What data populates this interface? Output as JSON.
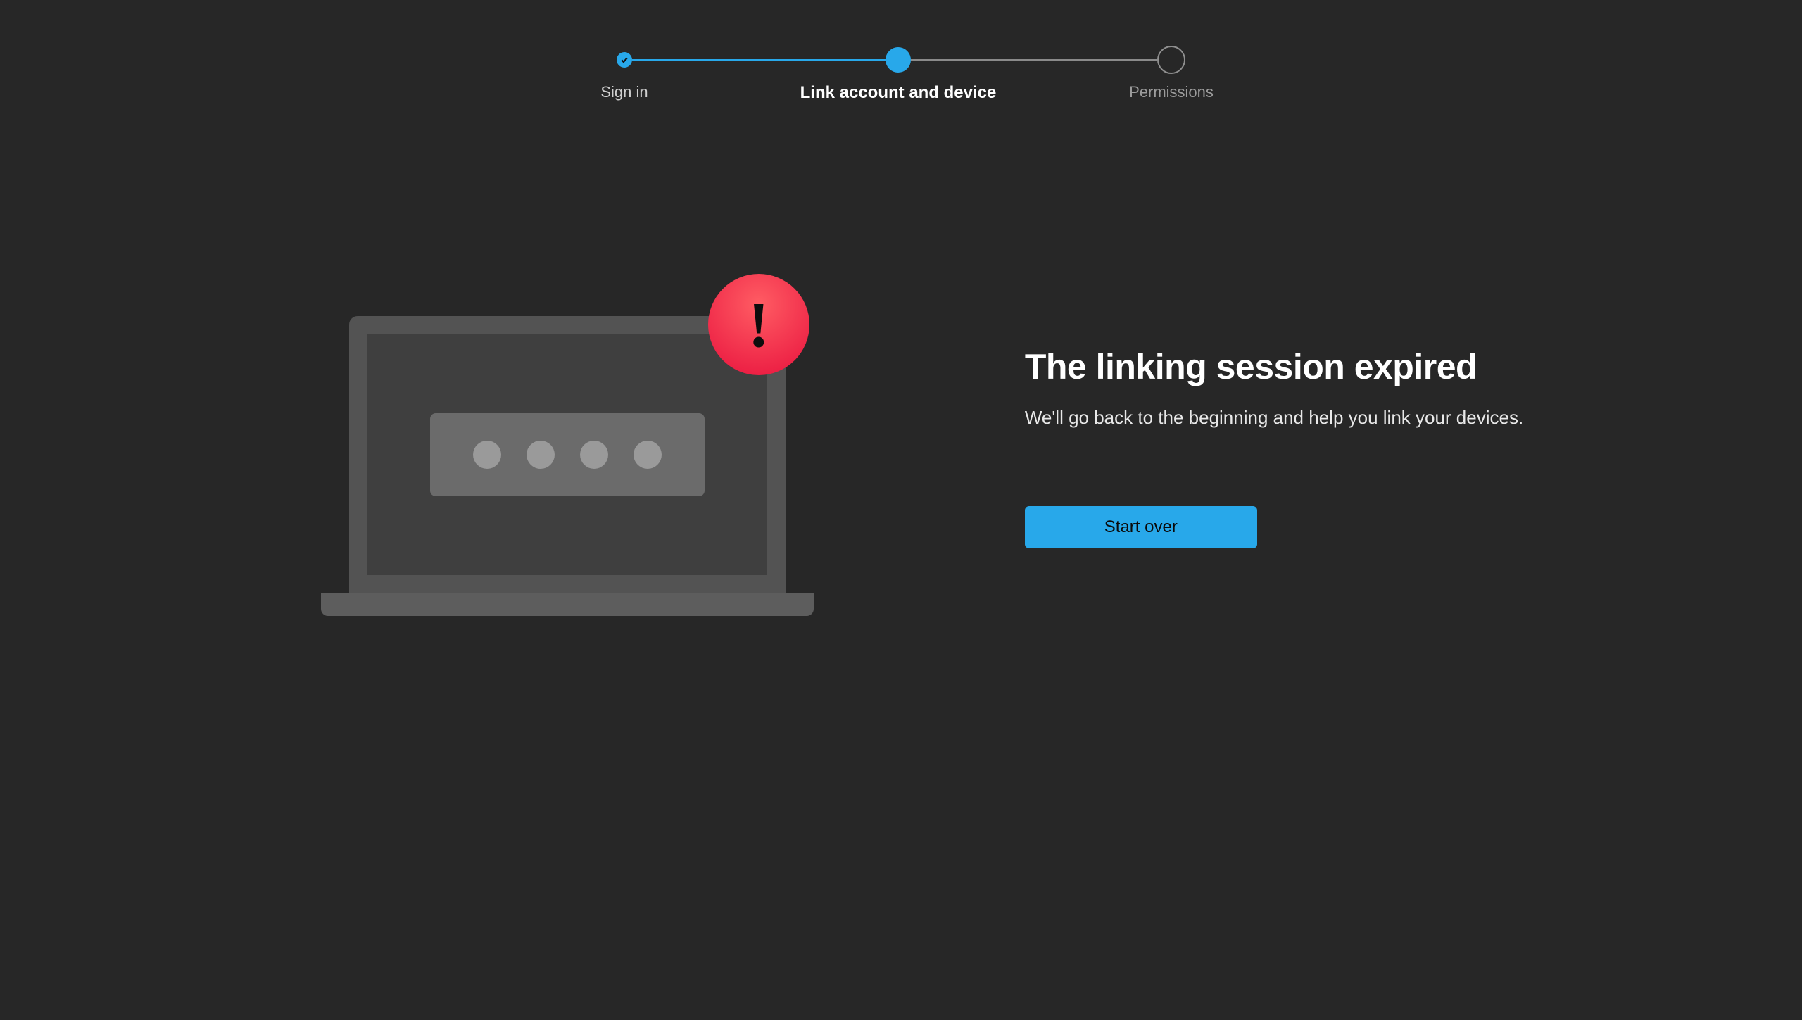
{
  "stepper": {
    "steps": [
      {
        "label": "Sign in",
        "state": "completed"
      },
      {
        "label": "Link account and device",
        "state": "current"
      },
      {
        "label": "Permissions",
        "state": "upcoming"
      }
    ]
  },
  "illustration": {
    "icon": "laptop-code-entry",
    "alert_icon": "exclamation-icon"
  },
  "message": {
    "title": "The linking session expired",
    "subtitle": "We'll go back to the beginning and help you link your devices."
  },
  "actions": {
    "primary_label": "Start over"
  },
  "colors": {
    "accent": "#28a8ea",
    "background": "#272727",
    "danger": "#e8123d"
  }
}
